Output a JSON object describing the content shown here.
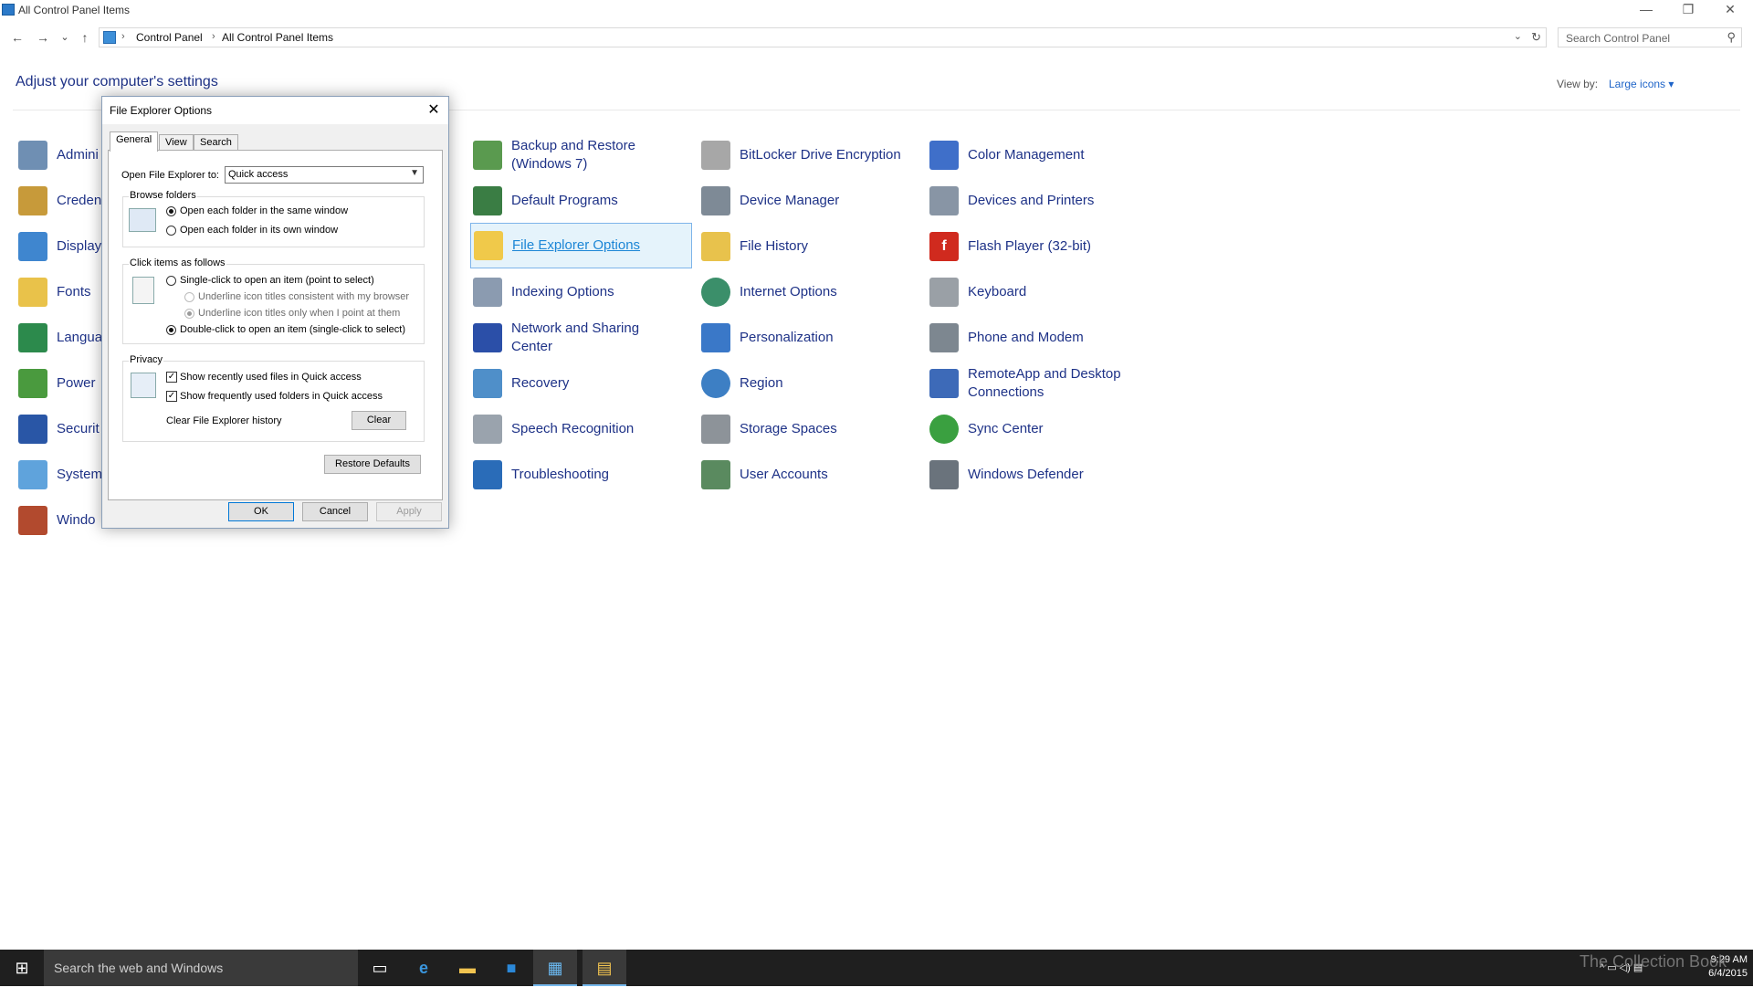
{
  "window": {
    "title": "All Control Panel Items",
    "minimize": "—",
    "restore": "❐",
    "close": "✕"
  },
  "address": {
    "back": "←",
    "forward": "→",
    "recent": "⌄",
    "up": "↑",
    "sep": "›",
    "crumbs": [
      "Control Panel",
      "All Control Panel Items"
    ],
    "dropdown": "⌄",
    "refresh": "↻",
    "search_placeholder": "Search Control Panel",
    "search_glyph": "⚲"
  },
  "content": {
    "heading": "Adjust your computer's settings",
    "view_by_label": "View by:",
    "view_by_value": "Large icons ▾"
  },
  "items_col0": [
    "Admini",
    "Creden",
    "Display",
    "Fonts",
    "Langua",
    "Power",
    "Securit",
    "System",
    "Windo"
  ],
  "items_col2": [
    "Backup and Restore\n(Windows 7)",
    "Default Programs",
    "File Explorer Options",
    "Indexing Options",
    "Network and Sharing\nCenter",
    "Recovery",
    "Speech Recognition",
    "Troubleshooting"
  ],
  "items_col3": [
    "BitLocker Drive Encryption",
    "Device Manager",
    "File History",
    "Internet Options",
    "Personalization",
    "Region",
    "Storage Spaces",
    "User Accounts"
  ],
  "items_col4": [
    "Color Management",
    "Devices and Printers",
    "Flash Player (32-bit)",
    "Keyboard",
    "Phone and Modem",
    "RemoteApp and Desktop\nConnections",
    "Sync Center",
    "Windows Defender"
  ],
  "dialog": {
    "title": "File Explorer Options",
    "close": "✕",
    "tabs": [
      "General",
      "View",
      "Search"
    ],
    "open_to_label": "Open File Explorer to:",
    "open_to_value": "Quick access",
    "browse_title": "Browse folders",
    "browse_same": "Open each folder in the same window",
    "browse_own": "Open each folder in its own window",
    "click_title": "Click items as follows",
    "single_click": "Single-click to open an item (point to select)",
    "underline_browser": "Underline icon titles consistent with my browser",
    "underline_point": "Underline icon titles only when I point at them",
    "double_click": "Double-click to open an item (single-click to select)",
    "privacy_title": "Privacy",
    "recent_files": "Show recently used files in Quick access",
    "frequent_folders": "Show frequently used folders in Quick access",
    "clear_history": "Clear File Explorer history",
    "clear_btn": "Clear",
    "restore_btn": "Restore Defaults",
    "ok": "OK",
    "cancel": "Cancel",
    "apply": "Apply",
    "check": "✓"
  },
  "taskbar": {
    "start": "⊞",
    "search_placeholder": "Search the web and Windows",
    "time": "9:29 AM",
    "date": "6/4/2015",
    "tray_glyphs": "^  ▭  ◁)  ▤",
    "watermark": "The Collection Book"
  }
}
